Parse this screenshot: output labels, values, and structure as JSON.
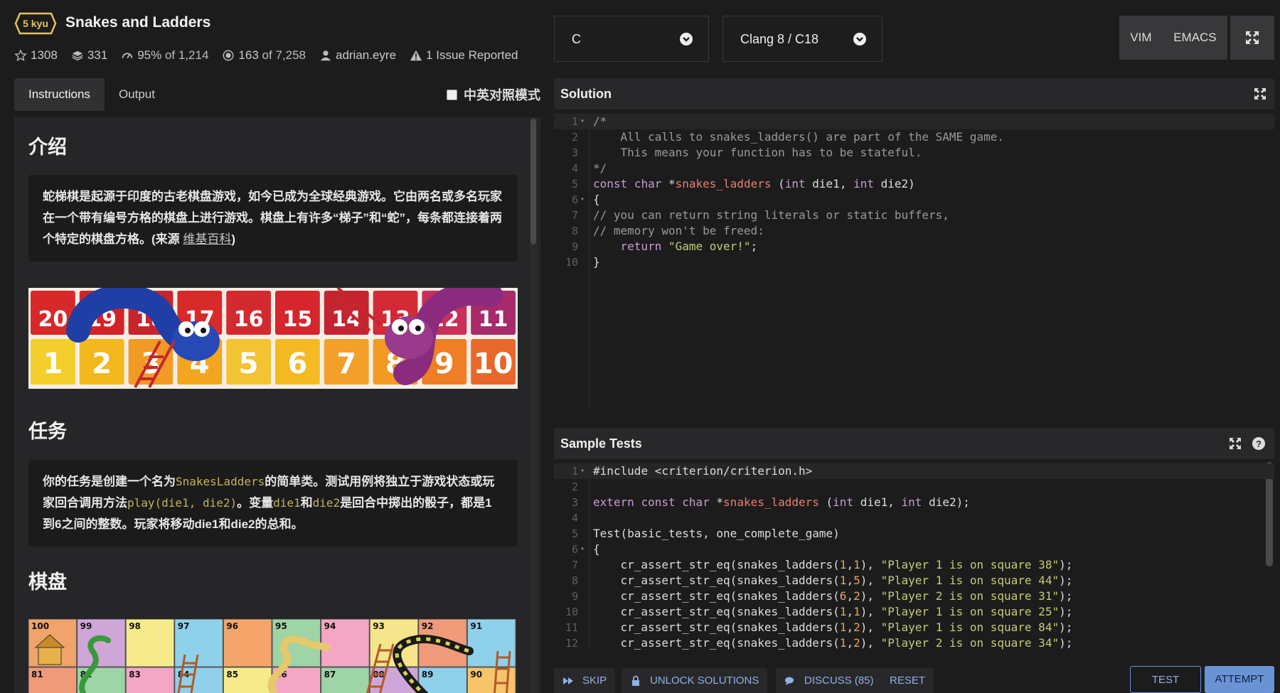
{
  "kata": {
    "rank": "5 kyu",
    "title": "Snakes and Ladders",
    "stats": {
      "stars": "1308",
      "collections": "331",
      "satisfaction": "95%",
      "satisfaction_of": "of 1,214",
      "completed": "163",
      "completed_of": "of 7,258",
      "author": "adrian.eyre",
      "issues": "1 Issue Reported"
    }
  },
  "language_select": {
    "value": "C"
  },
  "version_select": {
    "value": "Clang 8 / C18"
  },
  "editor_modes": {
    "vim": "VIM",
    "emacs": "EMACS"
  },
  "tabs": {
    "instructions": "Instructions",
    "output": "Output"
  },
  "bilingual_toggle": {
    "label": "中英对照模式"
  },
  "instructions": {
    "intro_heading": "介绍",
    "intro_text": "蛇梯棋是起源于印度的古老棋盘游戏，如今已成为全球经典游戏。它由两名或多名玩家在一个带有编号方格的棋盘上进行游戏。棋盘上有许多“梯子”和“蛇”，每条都连接着两个特定的棋盘方格。(来源 ",
    "intro_link": "维基百科",
    "intro_close": ")",
    "task_heading": "任务",
    "task_p1": "你的任务是创建一个名为",
    "task_code1": "SnakesLadders",
    "task_p2": "的简单类。测试用例将独立于游戏状态或玩家回合调用方法",
    "task_code2": "play(die1, die2)",
    "task_p3": "。变量",
    "task_code3": "die1",
    "task_p4": "和",
    "task_code4": "die2",
    "task_p5": "是回合中掷出的骰子，都是1到6之间的整数。玩家将移动die1和die2的总和。",
    "board_heading": "棋盘",
    "banner_numbers": [
      "20",
      "19",
      "18",
      "17",
      "16",
      "15",
      "14",
      "13",
      "12",
      "11",
      "1",
      "2",
      "3",
      "4",
      "5",
      "6",
      "7",
      "8",
      "9",
      "10"
    ],
    "board_numbers": [
      "100",
      "99",
      "98",
      "97",
      "96",
      "95",
      "94",
      "93",
      "92",
      "91",
      "81",
      "82",
      "83",
      "84",
      "85",
      "86",
      "87",
      "88",
      "89",
      "90"
    ]
  },
  "solution": {
    "title": "Solution",
    "lines": [
      "/*",
      "    All calls to snakes_ladders() are part of the SAME game.",
      "    This means your function has to be stateful.",
      "*/",
      "const char *snakes_ladders (int die1, int die2)",
      "{",
      "// you can return string literals or static buffers,",
      "// memory won't be freed:",
      "    return \"Game over!\";",
      "}"
    ]
  },
  "sample_tests": {
    "title": "Sample Tests",
    "lines": [
      "#include <criterion/criterion.h>",
      "",
      "extern const char *snakes_ladders (int die1, int die2);",
      "",
      "Test(basic_tests, one_complete_game)",
      "{",
      "    cr_assert_str_eq(snakes_ladders(1,1), \"Player 1 is on square 38\");",
      "    cr_assert_str_eq(snakes_ladders(1,5), \"Player 1 is on square 44\");",
      "    cr_assert_str_eq(snakes_ladders(6,2), \"Player 2 is on square 31\");",
      "    cr_assert_str_eq(snakes_ladders(1,1), \"Player 1 is on square 25\");",
      "    cr_assert_str_eq(snakes_ladders(1,2), \"Player 1 is on square 84\");",
      "    cr_assert_str_eq(snakes_ladders(1,2), \"Player 2 is on square 34\");"
    ]
  },
  "actions": {
    "skip": "SKIP",
    "unlock": "UNLOCK SOLUTIONS",
    "discuss": "DISCUSS (85)",
    "reset": "RESET",
    "test": "TEST",
    "attempt": "ATTEMPT"
  },
  "colors": {
    "accent": "#6a93d6",
    "rank": "#e6c35c",
    "code_highlight": "#c5b356"
  }
}
